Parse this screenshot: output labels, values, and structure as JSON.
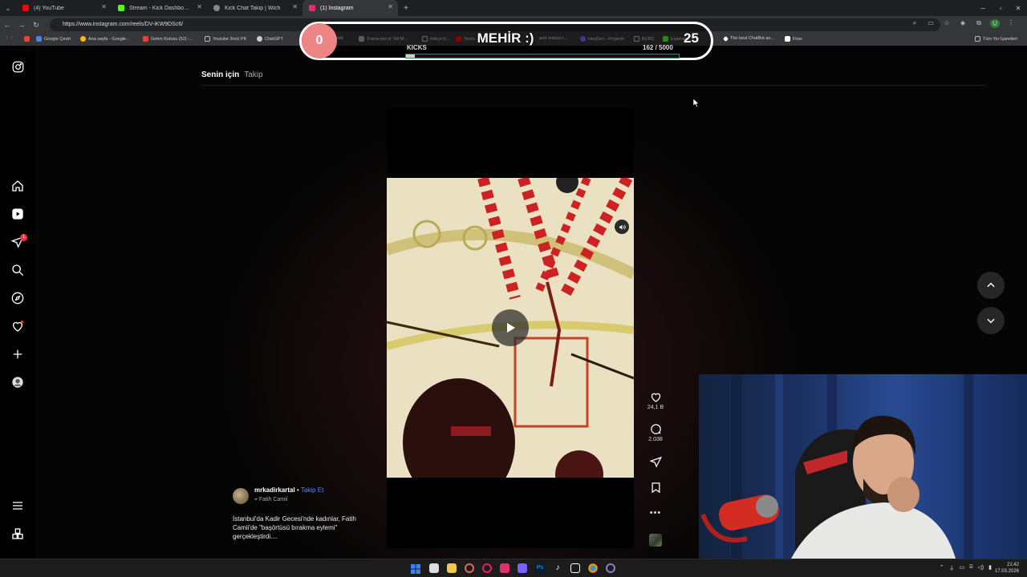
{
  "browser": {
    "tabs": [
      {
        "title": "(4) YouTube",
        "color": "#ff0000"
      },
      {
        "title": "Stream - Kick Dashboard",
        "color": "#53fc18"
      },
      {
        "title": "Kick Chat Takip | Wich",
        "color": "#888888"
      },
      {
        "title": "(1) Instagram",
        "color": "#e1306c"
      }
    ],
    "url": "https://www.instagram.com/reels/DV-iKW9DSc6/",
    "profile_initial": "U",
    "bookmarks": [
      {
        "label": "Google Çeviri",
        "color": "#4285f4"
      },
      {
        "label": "Ana sayfa - Google...",
        "color": "#fbbc04"
      },
      {
        "label": "Gelen Kutusu (52) -...",
        "color": "#ea4335"
      },
      {
        "label": "Youtube 3ncü PK",
        "color": "#8a8a8a"
      },
      {
        "label": "ChatGPT",
        "color": "#cccccc"
      },
      {
        "label": "Örnek",
        "color": "#888888"
      },
      {
        "label": "Transcript of \"All M...",
        "color": "#aaaaaa"
      },
      {
        "label": "türkçe h...",
        "color": "#aaaaaa"
      },
      {
        "label": "Youtu...",
        "color": "#ff0000"
      },
      {
        "label": "and reduce i...",
        "color": "#aaaaaa"
      },
      {
        "label": "HeyGen - Projects",
        "color": "#7b61ff"
      },
      {
        "label": "BURÇ",
        "color": "#8a8a8a"
      },
      {
        "label": "Esperan...",
        "color": "#53fc18"
      },
      {
        "label": "The best ChatBot an...",
        "color": "#ffffff"
      },
      {
        "label": "Flow",
        "color": "#ffffff"
      }
    ],
    "all_bookmarks": "Tüm Yer İşaretleri"
  },
  "instagram": {
    "feed_tabs": {
      "for_you": "Senin için",
      "following": "Takip"
    },
    "notification_count": "1",
    "reel": {
      "likes": "24,1 B",
      "comments": "2.038",
      "username": "mrkadirkartal",
      "separator": "•",
      "follow": "Takip Et",
      "location": "Fatih Camii",
      "caption": "İstanbul'da Kadir Gecesi'nde kadınlar, Fatih Camii'de \"başörtüsü bırakma eylemi\" gerçekleştirdi...."
    }
  },
  "overlay": {
    "title": "MEHİR :)",
    "left_count": "0",
    "right_count": "25",
    "kicks_label": "KICKS",
    "kicks_progress": "162 / 5000",
    "kicks_fraction": 0.0324
  },
  "taskbar": {
    "time": "21:42",
    "date": "17.03.2026",
    "app_colors": [
      "#3c82f6",
      "#dddddd",
      "#f2c94c",
      "#e06666",
      "#e0245e",
      "#e1306c",
      "#7b61ff",
      "#31a8ff",
      "#ffffff",
      "#ffffff",
      "#4caf50",
      "#8e7cc3"
    ]
  },
  "colors": {
    "follow_blue": "#5b8af0",
    "badge_red": "#ff3040",
    "kick_green": "#53fc18",
    "counter_red": "#ee8585"
  }
}
